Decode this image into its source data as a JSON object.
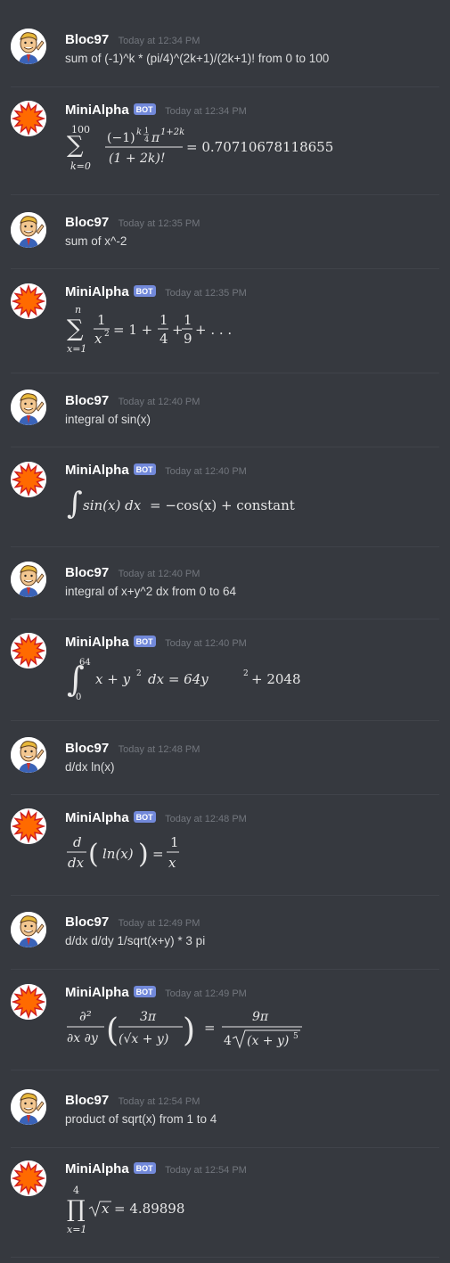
{
  "users": {
    "human": "Bloc97",
    "bot": "MiniAlpha",
    "bot_tag": "BOT"
  },
  "colors": {
    "background": "#36393f",
    "username": "#ffffff",
    "timestamp": "#72767d",
    "bot_tag": "#7289da",
    "bot_avatar": "#ff6a00"
  },
  "icons": {
    "human_avatar": "vault-boy-avatar-icon",
    "bot_avatar": "orange-starburst-avatar-icon"
  },
  "messages": [
    {
      "author": "Bloc97",
      "time": "Today at 12:34 PM",
      "text": "sum of (-1)^k * (pi/4)^(2k+1)/(2k+1)! from 0 to 100"
    },
    {
      "author": "MiniAlpha",
      "time": "Today at 12:34 PM",
      "math": {
        "upper": "100",
        "lower": "k=0",
        "num": "(−1)",
        "num_sup_k": "k",
        "quarter_num": "1",
        "quarter_den": "4",
        "pi": "π",
        "num_sup": "1+2k",
        "den": "(1 + 2k)!",
        "rhs": "= 0.70710678118655"
      }
    },
    {
      "author": "Bloc97",
      "time": "Today at 12:35 PM",
      "text": "sum of x^-2"
    },
    {
      "author": "MiniAlpha",
      "time": "Today at 12:35 PM",
      "math": {
        "upper": "n",
        "lower": "x=1",
        "num": "1",
        "den": "x",
        "den_sup": "2",
        "rhs1": "= 1 +",
        "f2_num": "1",
        "f2_den": "4",
        "plus": "+",
        "f3_num": "1",
        "f3_den": "9",
        "tail": "+ . . ."
      }
    },
    {
      "author": "Bloc97",
      "time": "Today at 12:40 PM",
      "text": "integral of sin(x)"
    },
    {
      "author": "MiniAlpha",
      "time": "Today at 12:40 PM",
      "math": {
        "integrand": "sin(x) dx",
        "rhs": "= −cos(x) + constant"
      }
    },
    {
      "author": "Bloc97",
      "time": "Today at 12:40 PM",
      "text": "integral of x+y^2 dx from 0 to 64"
    },
    {
      "author": "MiniAlpha",
      "time": "Today at 12:40 PM",
      "math": {
        "upper": "64",
        "lower": "0",
        "integrand": "x + y",
        "sup": "2",
        "dx": "dx = 64y",
        "rhs_sup": "2",
        "rhs_tail": "+ 2048"
      }
    },
    {
      "author": "Bloc97",
      "time": "Today at 12:48 PM",
      "text": "d/dx ln(x)"
    },
    {
      "author": "MiniAlpha",
      "time": "Today at 12:48 PM",
      "math": {
        "d_num": "d",
        "d_den": "dx",
        "inner": "ln(x)",
        "eq": "=",
        "r_num": "1",
        "r_den": "x"
      }
    },
    {
      "author": "Bloc97",
      "time": "Today at 12:49 PM",
      "text": "d/dx d/dy 1/sqrt(x+y) * 3 pi"
    },
    {
      "author": "MiniAlpha",
      "time": "Today at 12:49 PM",
      "math": {
        "d_num": "∂²",
        "d_den": "∂x ∂y",
        "in_num": "3π",
        "in_den": "(√x + y)",
        "eq": "=",
        "r_num": "9π",
        "r_den_pre": "4",
        "r_den_rad": "(x + y)",
        "r_den_sup": "5"
      }
    },
    {
      "author": "Bloc97",
      "time": "Today at 12:54 PM",
      "text": "product of sqrt(x) from 1 to 4"
    },
    {
      "author": "MiniAlpha",
      "time": "Today at 12:54 PM",
      "math": {
        "upper": "4",
        "lower": "x=1",
        "radicand": "x",
        "rhs": "= 4.89898"
      }
    }
  ]
}
